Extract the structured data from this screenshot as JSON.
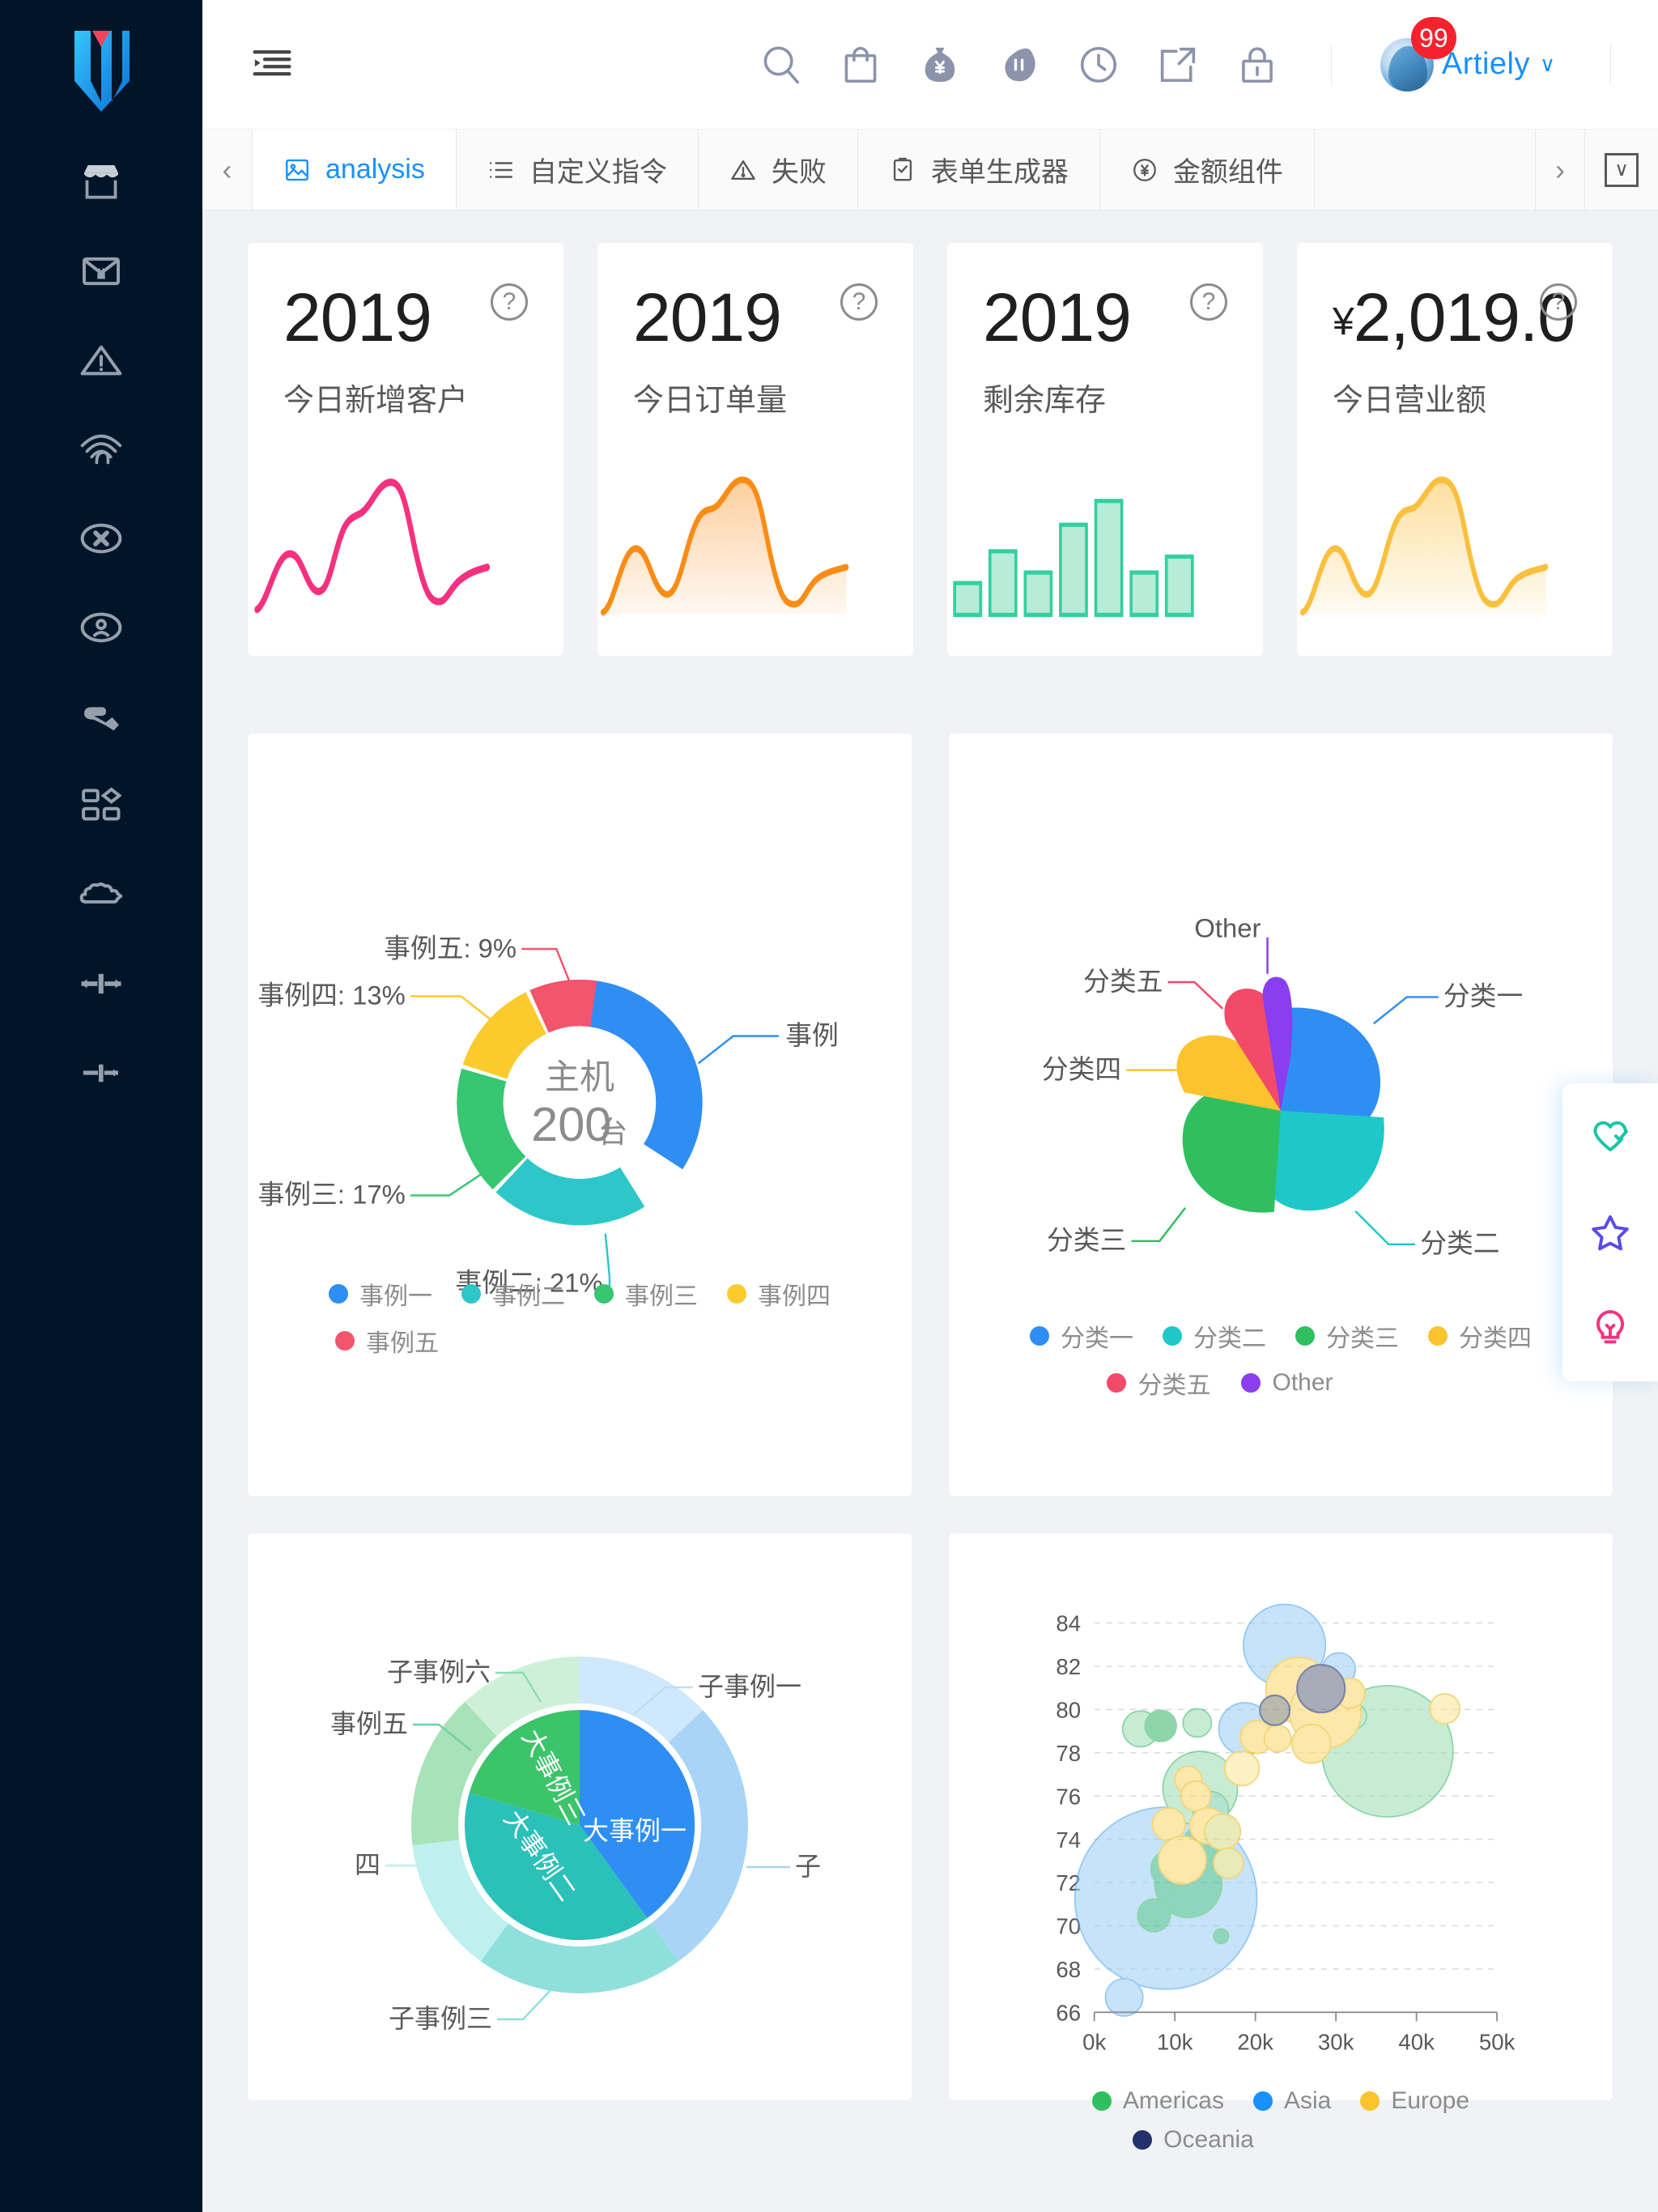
{
  "sidebar": {
    "logo_name": "brand-logo",
    "items": [
      {
        "icon": "shop-icon",
        "name": "sidebar-item-shop"
      },
      {
        "icon": "envelope-yen-icon",
        "name": "sidebar-item-billing"
      },
      {
        "icon": "warning-triangle-icon",
        "name": "sidebar-item-warning"
      },
      {
        "icon": "wifi-icon",
        "name": "sidebar-item-network"
      },
      {
        "icon": "circle-close-icon",
        "name": "sidebar-item-error"
      },
      {
        "icon": "user-circle-icon",
        "name": "sidebar-item-account"
      },
      {
        "icon": "wrench-icon",
        "name": "sidebar-item-tools"
      },
      {
        "icon": "apps-grid-icon",
        "name": "sidebar-item-apps"
      },
      {
        "icon": "cloud-puzzle-icon",
        "name": "sidebar-item-plugins"
      },
      {
        "icon": "slider-icon",
        "name": "sidebar-item-settings-1"
      },
      {
        "icon": "slider-icon",
        "name": "sidebar-item-settings-2"
      }
    ]
  },
  "header": {
    "collapse_icon": "menu-fold-icon",
    "icons": [
      {
        "name": "search-icon"
      },
      {
        "name": "shopping-bag-icon"
      },
      {
        "name": "money-bag-yen-icon"
      },
      {
        "name": "chat-bubble-icon"
      },
      {
        "name": "clock-icon"
      },
      {
        "name": "external-link-icon"
      },
      {
        "name": "lock-icon"
      }
    ],
    "user": {
      "name": "Artiely",
      "badge_count": "99",
      "caret": "∨"
    }
  },
  "tabbar": {
    "scroll_left": "‹",
    "scroll_right": "›",
    "dropdown": "∨",
    "tabs": [
      {
        "label": "analysis",
        "icon": "image-chart-icon",
        "active": true
      },
      {
        "label": "自定义指令",
        "icon": "list-icon",
        "active": false
      },
      {
        "label": "失败",
        "icon": "warning-triangle-icon",
        "active": false
      },
      {
        "label": "表单生成器",
        "icon": "form-icon",
        "active": false
      },
      {
        "label": "金额组件",
        "icon": "yen-circle-icon",
        "active": false
      }
    ]
  },
  "stats": [
    {
      "value": "2019",
      "currency": "",
      "label": "今日新增客户",
      "help": "?",
      "spark_type": "line",
      "color": "#f5317f"
    },
    {
      "value": "2019",
      "currency": "",
      "label": "今日订单量",
      "help": "?",
      "spark_type": "area",
      "color": "#fa8c16"
    },
    {
      "value": "2019",
      "currency": "",
      "label": "剩余库存",
      "help": "?",
      "spark_type": "bar",
      "color": "#36cfa0"
    },
    {
      "value": "2,019.0",
      "currency": "¥",
      "label": "今日营业额",
      "help": "?",
      "spark_type": "area",
      "color": "#fac03d"
    }
  ],
  "chart_data": [
    {
      "type": "pie",
      "name": "host-donut-chart",
      "title": "",
      "center_title": "主机",
      "center_value": "200",
      "center_unit": "台",
      "labels": [
        "事例一",
        "事例二",
        "事例三",
        "事例四",
        "事例五"
      ],
      "values": [
        40,
        21,
        17,
        13,
        9
      ],
      "callout_labels": [
        "事例",
        "事例二: 21%",
        "事例三: 17%",
        "事例四: 13%",
        "事例五: 9%"
      ],
      "colors": [
        "#2f8ef4",
        "#2ec7c9",
        "#37c671",
        "#fbcb2e",
        "#f3556d"
      ],
      "legend": [
        "事例一",
        "事例二",
        "事例三",
        "事例四",
        "事例五"
      ],
      "legend_position": "bottom"
    },
    {
      "type": "pie",
      "name": "category-rose-chart",
      "title": "",
      "labels": [
        "分类一",
        "分类二",
        "分类三",
        "分类四",
        "分类五",
        "Other"
      ],
      "values": [
        30,
        28,
        22,
        14,
        8,
        2
      ],
      "colors": [
        "#2f8ef4",
        "#1ec8c8",
        "#2fbf5f",
        "#fbc42e",
        "#f24a68",
        "#8b3df0"
      ],
      "legend": [
        "分类一",
        "分类二",
        "分类三",
        "分类四",
        "分类五",
        "Other"
      ],
      "legend_position": "bottom"
    },
    {
      "type": "pie",
      "name": "sunburst-chart",
      "title": "",
      "inner_labels": [
        "大事例一",
        "大事例二",
        "大事例三"
      ],
      "inner_values": [
        40,
        33,
        27
      ],
      "inner_colors": [
        "#2f8ef4",
        "#2bc0b8",
        "#3cc46a"
      ],
      "outer_labels": [
        "子事例一",
        "子",
        "子事例三",
        "四",
        "事例五",
        "子事例六"
      ],
      "outer_values": [
        13,
        27,
        20,
        13,
        15,
        12
      ],
      "outer_colors": [
        "#cfe8fb",
        "#a7d4f7",
        "#8fe0dd",
        "#bdf0ee",
        "#a8e2b8",
        "#cff0d8"
      ]
    },
    {
      "type": "scatter",
      "name": "life-expectancy-bubble-chart",
      "title": "",
      "xlabel": "",
      "ylabel": "",
      "xticks": [
        "0k",
        "10k",
        "20k",
        "30k",
        "40k",
        "50k"
      ],
      "yticks": [
        "66",
        "68",
        "70",
        "72",
        "74",
        "76",
        "78",
        "80",
        "82",
        "84"
      ],
      "xlim": [
        0,
        55000
      ],
      "ylim": [
        66,
        84
      ],
      "grid": true,
      "legend": [
        "Americas",
        "Asia",
        "Europe",
        "Oceania"
      ],
      "legend_colors": [
        "#2fbf5f",
        "#1890ff",
        "#fbc42e",
        "#22306b"
      ],
      "legend_position": "bottom",
      "series": [
        {
          "name": "Asia",
          "color": "#1890ff",
          "points": [
            {
              "x": 7500,
              "y": 72.8,
              "r": 190
            },
            {
              "x": 31000,
              "y": 82.8,
              "r": 72
            },
            {
              "x": 41000,
              "y": 82.0,
              "r": 23
            },
            {
              "x": 22500,
              "y": 78.9,
              "r": 42
            },
            {
              "x": 2500,
              "y": 67.4,
              "r": 28
            }
          ]
        },
        {
          "name": "Europe",
          "color": "#fbc42e",
          "points": [
            {
              "x": 28000,
              "y": 81.0,
              "r": 58
            },
            {
              "x": 33000,
              "y": 79.9,
              "r": 64
            },
            {
              "x": 50000,
              "y": 80.1,
              "r": 26
            },
            {
              "x": 20000,
              "y": 78.2,
              "r": 30
            },
            {
              "x": 23000,
              "y": 76.6,
              "r": 30
            },
            {
              "x": 13000,
              "y": 75.5,
              "r": 26
            },
            {
              "x": 15500,
              "y": 73.8,
              "r": 30
            },
            {
              "x": 14000,
              "y": 72.4,
              "r": 34
            },
            {
              "x": 36500,
              "y": 81.6,
              "r": 22
            },
            {
              "x": 19500,
              "y": 73.6,
              "r": 26
            }
          ]
        },
        {
          "name": "Americas",
          "color": "#2fbf5f",
          "points": [
            {
              "x": 41500,
              "y": 78.4,
              "r": 130
            },
            {
              "x": 11000,
              "y": 76.6,
              "r": 70
            },
            {
              "x": 4000,
              "y": 78.5,
              "r": 32
            },
            {
              "x": 6500,
              "y": 78.6,
              "r": 26
            },
            {
              "x": 12500,
              "y": 78.8,
              "r": 22
            },
            {
              "x": 36000,
              "y": 79.0,
              "r": 26
            },
            {
              "x": 9500,
              "y": 72.4,
              "r": 60
            },
            {
              "x": 11500,
              "y": 74.0,
              "r": 42
            },
            {
              "x": 7500,
              "y": 72.8,
              "r": 34
            },
            {
              "x": 6000,
              "y": 70.2,
              "r": 30
            },
            {
              "x": 18000,
              "y": 69.7,
              "r": 12
            },
            {
              "x": 13500,
              "y": 75.8,
              "r": 30
            }
          ]
        },
        {
          "name": "Oceania",
          "color": "#22306b",
          "points": [
            {
              "x": 32500,
              "y": 81.2,
              "r": 38
            },
            {
              "x": 24500,
              "y": 80.1,
              "r": 23
            }
          ]
        }
      ]
    }
  ],
  "float_panel": {
    "buttons": [
      {
        "name": "heart-check-icon",
        "color": "#15c5a5"
      },
      {
        "name": "star-icon",
        "color": "#5b4be8"
      },
      {
        "name": "lightbulb-icon",
        "color": "#f5317f"
      }
    ]
  }
}
